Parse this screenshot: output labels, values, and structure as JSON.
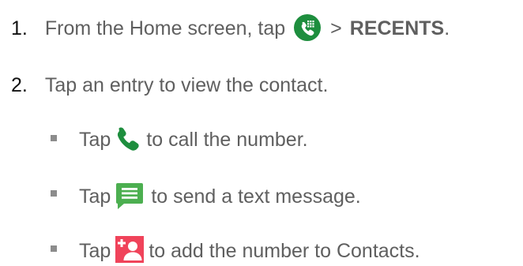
{
  "steps": [
    {
      "number": "1.",
      "text_before": "From the Home screen, tap",
      "icon": "phone-app-icon",
      "separator": ">",
      "text_bold": "RECENTS",
      "text_after": "."
    },
    {
      "number": "2.",
      "text": "Tap an entry to view the contact."
    }
  ],
  "substeps": [
    {
      "prefix": "Tap",
      "icon": "phone-call-icon",
      "text": "to call the number."
    },
    {
      "prefix": "Tap",
      "icon": "message-icon",
      "text": "to send a text message."
    },
    {
      "prefix": "Tap",
      "icon": "add-contact-icon",
      "text": "to add the number to Contacts."
    }
  ],
  "colors": {
    "text": "#5f5f5f",
    "number": "#111111",
    "bullet": "#8c8c8c",
    "phone_green": "#1e8e3e",
    "message_green": "#4caf50",
    "contact_red": "#f0435a"
  }
}
